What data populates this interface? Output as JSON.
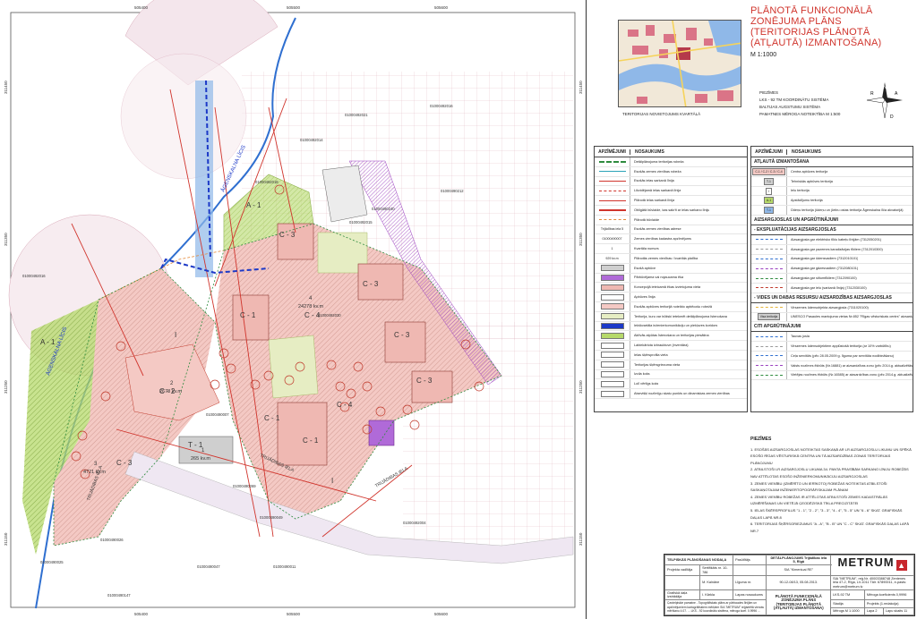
{
  "title": "PLĀNOTĀ FUNKCIONĀLĀ ZONĒJUMA PLĀNS (TERITORIJAS PLĀNOTĀ (ATĻAUTĀ) IZMANTOŠANA)",
  "scale": "M 1:1000",
  "inset_caption": "TERITORIJAS NOVIETOJUMS KVARTĀLĀ",
  "notes_header": {
    "label": "PIEZĪMES",
    "lines": [
      "LKS - 92 TM KOORDINĀTU SISTĒMA",
      "BALTIJAS AUGSTUMU SISTĒMA",
      "PAMATNES MĒROGA NOTEIKTĪBA M 1:500"
    ]
  },
  "compass": {
    "n": "N",
    "s": "D",
    "e": "A",
    "w": "R"
  },
  "map": {
    "coords_top": [
      "505400",
      "505500",
      "505600"
    ],
    "coords_bottom": [
      "505400",
      "505500",
      "505600"
    ],
    "coords_left": [
      "311450",
      "311350",
      "311250",
      "311150"
    ],
    "coords_right": [
      "311450",
      "311350",
      "311250",
      "311150"
    ],
    "streets": [
      "ĀGENSKALNA LĪCIS",
      "ĀGENSKALNA LĪCIS",
      "TRIJĀDIBAS IELA",
      "TRIJĀDIBAS IELA",
      "TRIJĀDIBAS IELA"
    ],
    "zones": [
      "A - 1",
      "A - 1",
      "C - 3",
      "C - 3",
      "C - 3",
      "C - 3",
      "C - 1",
      "C - 4",
      "C - 4",
      "C - 1",
      "C - 2",
      "C - 3",
      "T - 1",
      "I",
      "I",
      "C - 1"
    ],
    "parcels": [
      "01000492021",
      "01000492016",
      "01000492014",
      "01000492018",
      "01000492016",
      "01000490212",
      "01000490240",
      "01000492015",
      "01000492030",
      "01000490007",
      "01000490269",
      "01000490049",
      "01000490026",
      "01000490025",
      "01000490047",
      "01000490147",
      "01000490011",
      "01000492004"
    ],
    "areas": [
      {
        "num": "4",
        "area": "24278 kv.m"
      },
      {
        "num": "2",
        "area": "2678 kv.m"
      },
      {
        "num": "3",
        "area": "4721 kv.m"
      },
      {
        "num": "1",
        "area": "265 kv.m"
      }
    ]
  },
  "legend_left": {
    "col1": "APZĪMĒJUMI",
    "col2": "NOSAUKUMS",
    "rows": [
      {
        "sym": "",
        "text": "Detālplānojuma teritorijas robeža"
      },
      {
        "sym": "",
        "text": "Esošās zemes vienības robeža"
      },
      {
        "sym": "",
        "text": "Esošās ielas sarkanā līnija"
      },
      {
        "sym": "",
        "text": "Likvidējamā ielas sarkanā līnija"
      },
      {
        "sym": "",
        "text": "Plānotā ielas sarkanā līnija"
      },
      {
        "sym": "",
        "text": "Obligātā būvlaide, kas sakrīt ar ielas sarkano līniju"
      },
      {
        "sym": "",
        "text": "Plānotā būvlaide"
      },
      {
        "sym": "Trijādības iela 5",
        "text": "Esošās zemes vienības adrese"
      },
      {
        "sym": "01000490007",
        "text": "Zemes vienības kadastra apzīmējums"
      },
      {
        "sym": "1",
        "text": "Kvartāla numurs"
      },
      {
        "sym": "929 kv.m",
        "text": "Plānotās zemes vienības / kvartāla platība"
      },
      {
        "sym": "",
        "text": "Esošā apbūve"
      },
      {
        "sym": "",
        "text": "Pārbūvējama vai nojaucama ēka"
      },
      {
        "sym": "",
        "text": "Koncepcijā ieteicamā ēkas izvietojuma vieta"
      },
      {
        "sym": "",
        "text": "Apbūves līnija"
      },
      {
        "sym": "",
        "text": "Esošās apbūves teritorijā noteikto apbēcošu robežā"
      },
      {
        "sym": "",
        "text": "Teritorija, kuru var būtiski ietekmēt detālplānojuma īstenošana"
      },
      {
        "sym": "",
        "text": "Iekškvartāla inženierkomunikāciju un piekļuves koridors"
      },
      {
        "sym": "",
        "text": "Aktīvās atpūtas īstenošana un teritorijas piesātina"
      },
      {
        "sym": "",
        "text": "Labiekārtota izbrauktuve (inventāra)"
      },
      {
        "sym": "",
        "text": "Ielas šķērsprofila vieta"
      },
      {
        "sym": "",
        "text": "Teritorijas šķērsgriezuma vieta"
      },
      {
        "sym": "",
        "text": "Izcila koks"
      },
      {
        "sym": "",
        "text": "Lolī vērtīgs koks"
      },
      {
        "sym": "",
        "text": "Atsevišķi nozīmīgu skatu punkts un dinamiskas zemes vienības"
      }
    ]
  },
  "legend_right": {
    "col1": "APZĪMĒJUMI",
    "col2": "NOSAUKUMS",
    "sections": [
      {
        "title": "ATĻAUTĀ IZMANTOŠANA",
        "rows": [
          {
            "sym": "C-1 / C-2 / C-3 / C-4",
            "text": "Centra apbūves teritorija"
          },
          {
            "sym": "T-1",
            "text": "Tehniskās apbūves teritorija"
          },
          {
            "sym": "I",
            "text": "Ielu teritorija"
          },
          {
            "sym": "A-1",
            "text": "Apstādījumu teritorija"
          },
          {
            "sym": "T-1",
            "text": "Ūdeņu teritorija (ūdeņu un jūrtiru ostas teritorija Āgenskalna līča akvatorijā)"
          }
        ]
      },
      {
        "title": "AIZSARGJOSLAS UN APGRŪTINĀJUMI",
        "rows": []
      },
      {
        "title": "- EKSPLUATĀCIJAS AIZSARGJOSLAS",
        "rows": [
          {
            "sym": "",
            "text": "Aizsargjosla gar elektrisko tīklu kabeļu līnijām (7312050201)"
          },
          {
            "sym": "",
            "text": "Aizsargjosla gar pazemes kanalizācijas tīkliem (7312010300)"
          },
          {
            "sym": "",
            "text": "Aizsargjosla gar ūdensvadiem (7312010101)"
          },
          {
            "sym": "",
            "text": "Aizsargjosla gar gāzesvadiem (7312080101)"
          },
          {
            "sym": "",
            "text": "Aizsargjosla gar siltumtīkliem (7312090100)"
          },
          {
            "sym": "",
            "text": "Aizsargjosla gar ielu (sarkanā līnija) (7312030100)"
          }
        ]
      },
      {
        "title": "- VIDES UN DABAS RESURSU AIZSARDZĪBAS AIZSARGJOSLAS",
        "rows": [
          {
            "sym": "",
            "text": "Virszemes ūdensobjekta aizsargjosla (7311020100)"
          },
          {
            "sym": "Visa teritorija",
            "text": "UNESCO Pasaules mantojuma vietas Nr.852 \"Rīgas vēsturiskais centrs\" aizsardzības zona"
          }
        ]
      },
      {
        "title": "CITI APGRŪTINĀJUMI",
        "rows": [
          {
            "sym": "",
            "text": "Tauvas josla"
          },
          {
            "sym": "",
            "text": "Virszemes ūdensobjektiem applūstošā teritorija (ar 10% varbūtību)"
          },
          {
            "sym": "",
            "text": "Ceļa servitūts (pēc 28.05.2009 g. līguma par servitūta nodibināšanu)"
          },
          {
            "sym": "",
            "text": "Valsts nozīmes ēkbūts (Nr.16881) ar aizsardzības zonu (pēc 2014.g. aktualizētās inventarizācijas)"
          },
          {
            "sym": "",
            "text": "Vietējas nozīmes ēkbūts (Nr.16585) ar aizsardzības zonu (pēc 2014.g. aktualizētās inventarizācijas)"
          }
        ]
      }
    ]
  },
  "piezimes": {
    "title": "PIEZĪMES",
    "items": [
      "1. ESOŠĀS AIZSARGJOSLAS NOTEIKTAS SASKAŅĀ AR LR AIZSARGJOSLU LIKUMU UN SPĒKĀ ESOŠO RĪGAS VĒSTURISKĀ CENTRA UN TĀ AIZSARDZĪBAS ZONAS TERITORIJAS PLĀNOJUMU",
      "2. ATBILSTOŠI LR AIZSARGJOSLU LIKUMA 34. PANTA PRASĪBĀM SARKANO LĪNIJU ROBEŽĀS NAV ATTĒLOTAS ESOŠO INŽENIERKOMUNIKĀCIJU AIZSARGJOSLAS",
      "3. ZEMES VIENĪBU (IZMĒRĪTO UN IERĪKOTO) ROBEŽAS NOTEIKTAS ATBILSTOŠI SASKAŅOTAJAM INŽENIERTOPOGRĀFISKAJAM PLĀNAM",
      "4. ZEMES VIENĪBU ROBEŽAS IR ATTĒLOTAS ATBILSTOŠI ZEMES KADASTRĀLĀS UZMĒRĪŠANAS UN VIETĒJĀ ĢEODĒZISKĀ TĪKLA PRECIZITĀTEI",
      "5. IELAS ŠĶĒRSPROFILUS \"1 - 1\", \"2 - 2\", \"3 - 3\", \"4 - 4\", \"5 - 5\" UN \"6 - 6\" SKAT. GRAFISKĀS DAĻAS LAPĀ NR.8",
      "6. TERITORIJAS ŠĶĒRSGRIEZUMUS \"A - A\", \"B - B\" UN \"C - C\" SKAT. GRAFISKĀS DAĻAS LAPĀ NR.7"
    ]
  },
  "stamp": {
    "org_header": "TELPISKĀS PLĀNOŠANAS NODAĻA",
    "rows": [
      {
        "k": "Projekta vadītāja",
        "v": "Sertifikāts nr. 10-786"
      },
      {
        "k": "",
        "v": "M. Kalnāne"
      },
      {
        "k": "Grafiskā daļa izstrādāja",
        "v": "I. Kārkla"
      }
    ],
    "project_label": "Pasūtītājs",
    "project_name": "DETĀLPLĀNOJUMS Trijādības iela 5, Rīgā",
    "client": "SIA \"Kimeniuai RE\"",
    "contract_label": "Līguma nr.",
    "contract_no": "90-12-08/13, 05.08.2013.",
    "sheet_label": "Lapas nosaukums",
    "sheet_title": "PLĀNOTĀ FUNKCIONĀLĀ ZONĒJUMA PLĀNS (TERITORIJAS PLĀNOTĀ (ATĻAUTĀ) IZMANTOŠANA)",
    "company": "METRUM",
    "company_info": "SIA \"METRUM\", reģ.Nr. 40003388748 Zentenes iela 47-2, Rīga, LV-1011 Tālr. 67890011, e-pasts: metrum@metrum.lv",
    "system": "LKS-92 TM",
    "scale_factor": "Mēroga koeficients 0,9996",
    "stadija_label": "Stadija",
    "stadija": "Projekts (1.redakcija)",
    "merogs_label": "Mērogs",
    "merogs": "M 1:1000",
    "lapa_label": "Lapa",
    "lapa": "2",
    "lapu_skaits_label": "Lapu skaits",
    "lapu_skaits": "11",
    "note": "Ģeotelpiskie pamatne - Topogrāfiskais plāns ar pārbaudes līnijām un apzīmējumiem kartogrāfiskiem mērķiem SIA \"METRUM\" reģistrētā vienotu mērīšanu 4.07. ... LKS - 92 koordinātu sistēma, mēroga koef. 0.9996 ..."
  },
  "colors": {
    "commercial": "#f4c9c4",
    "green": "#b6d96a",
    "street": "#efe7f2",
    "water": "#8fb8e8",
    "red_line": "#d0342c",
    "title_red": "#d0342c",
    "purple": "#9a3fbf"
  }
}
